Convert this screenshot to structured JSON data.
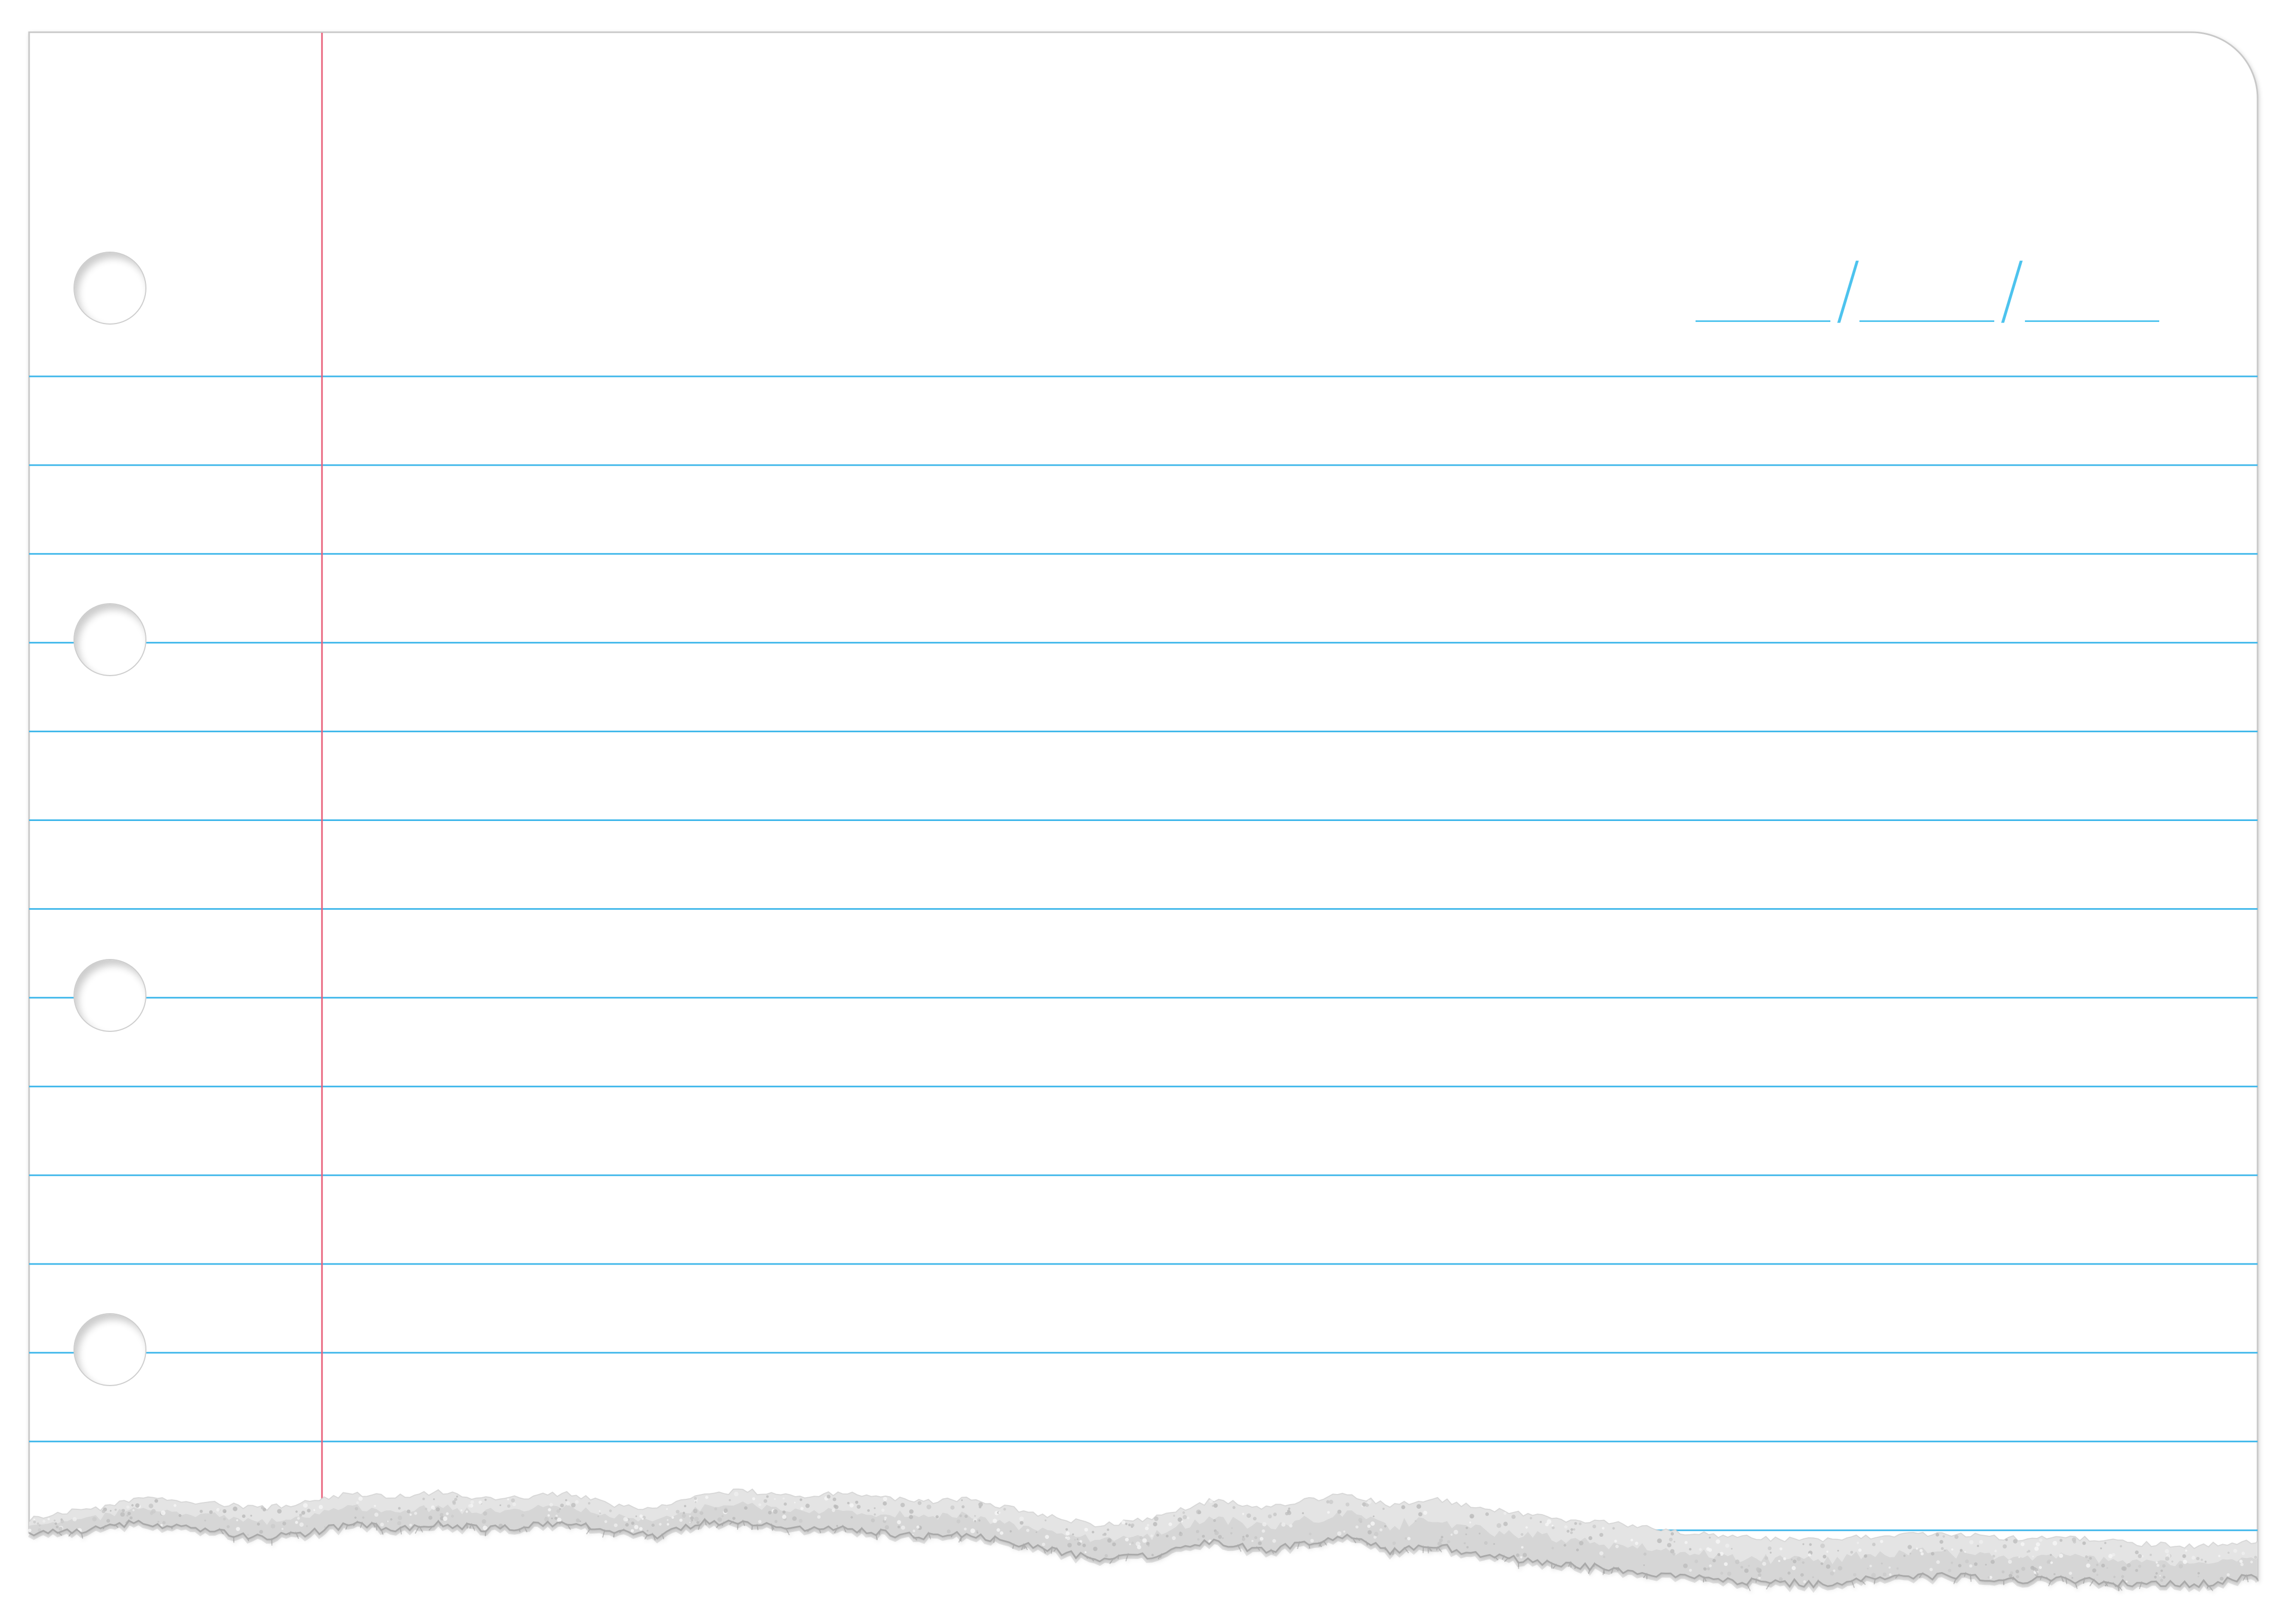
{
  "date_field": {
    "separators": [
      "/",
      "/"
    ]
  },
  "colors": {
    "paper": "#ffffff",
    "paper_edge": "#c8c8c8",
    "rule_line": "#3cb6ea",
    "margin_line": "#e8607a",
    "date_field": "#4dc3ee",
    "torn_edge": "#d6d6d6"
  }
}
